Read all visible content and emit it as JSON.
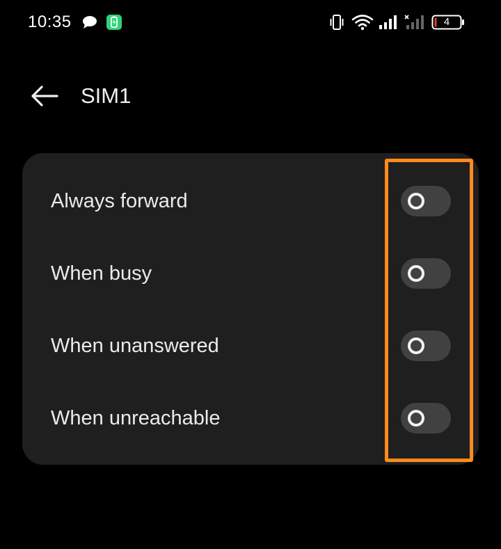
{
  "status_bar": {
    "time": "10:35",
    "battery_level": "4",
    "icons": [
      "message-icon",
      "battery-saver-icon",
      "vibrate-icon",
      "wifi-icon",
      "cell-signal-icon",
      "cell-signal-no-service-icon",
      "battery-icon"
    ]
  },
  "header": {
    "title": "SIM1",
    "back_icon": "back-arrow-icon"
  },
  "call_forwarding": {
    "items": [
      {
        "label": "Always forward",
        "enabled": false
      },
      {
        "label": "When busy",
        "enabled": false
      },
      {
        "label": "When unanswered",
        "enabled": false
      },
      {
        "label": "When unreachable",
        "enabled": false
      }
    ]
  },
  "colors": {
    "background": "#000000",
    "card": "#1f1f1f",
    "toggle_off_track": "#414141",
    "highlight": "#ff8a1f",
    "battery_saver": "#2ed47a",
    "battery_low": "#e53935"
  }
}
